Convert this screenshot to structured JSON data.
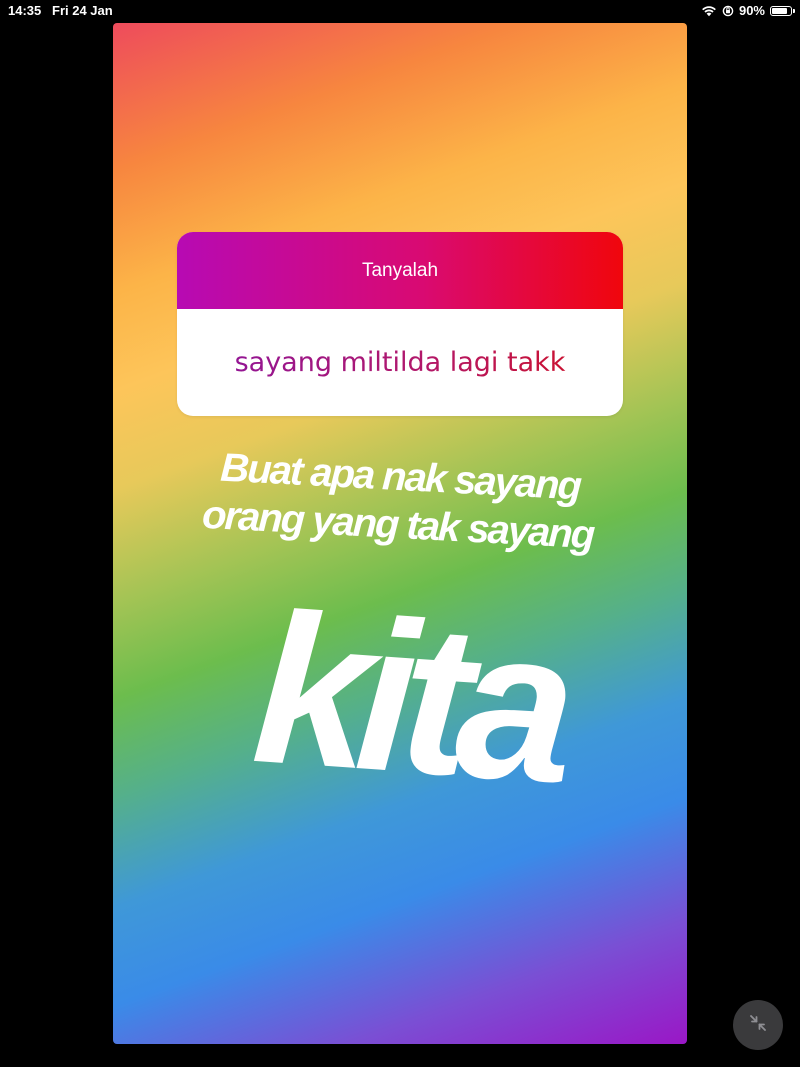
{
  "status_bar": {
    "time": "14:35",
    "date": "Fri 24 Jan",
    "battery_percent": "90%",
    "battery_level": 0.9,
    "icons": [
      "wifi-icon",
      "orientation-lock-icon",
      "battery-icon"
    ]
  },
  "story": {
    "question_sticker": {
      "header": "Tanyalah",
      "answer": "sayang miltilda lagi takk"
    },
    "caption_lines": [
      "Buat apa nak sayang",
      "orang yang tak sayang"
    ],
    "big_word": "kita"
  },
  "controls": {
    "minimize_icon": "minimize-arrows-icon"
  },
  "colors": {
    "background": "#000000",
    "sticker_gradient": [
      "#b70ab3",
      "#d90a72",
      "#f0060c"
    ],
    "story_gradient": [
      "#ee4b5c",
      "#f7863f",
      "#fdc55a",
      "#6cbd4d",
      "#3a8be8",
      "#9a17c6"
    ]
  }
}
